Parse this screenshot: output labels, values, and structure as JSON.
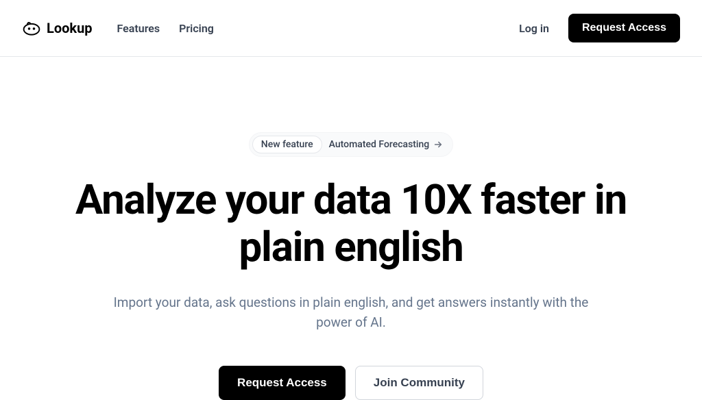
{
  "navbar": {
    "logo_text": "Lookup",
    "links": {
      "features": "Features",
      "pricing": "Pricing"
    },
    "login": "Log in",
    "request_access": "Request Access"
  },
  "hero": {
    "badge_pill": "New feature",
    "badge_text": "Automated Forecasting",
    "title": "Analyze your data 10X faster in plain english",
    "subtitle": "Import your data, ask questions in plain english, and get answers instantly with the power of AI.",
    "cta_primary": "Request Access",
    "cta_secondary": "Join Community"
  }
}
